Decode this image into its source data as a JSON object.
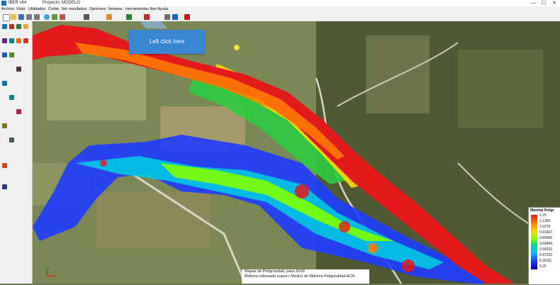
{
  "window": {
    "app_title": "IBER v64",
    "project_title": "Proyecto: MODELO",
    "minimize_glyph": "—",
    "maximize_glyph": "☐",
    "close_glyph": "✕"
  },
  "menubar": {
    "items": [
      "Archivo",
      "Vista",
      "Utilidades",
      "Cortar",
      "Ver resultados",
      "Opciones",
      "Ventana",
      "Herramientas Iber",
      "Ayuda"
    ]
  },
  "toolbar": {
    "icons": [
      "new-icon",
      "open-icon",
      "save-icon",
      "undo-icon",
      "redo-icon",
      "zoom-icon",
      "pan-icon",
      "rotate-icon",
      "print-icon",
      "layers-icon",
      "render-icon",
      "results-icon",
      "settings-icon",
      "help-icon",
      "exit-icon"
    ]
  },
  "sidebar": {
    "icons": [
      "point-icon",
      "line-icon",
      "arc-icon",
      "polyline-icon",
      "surface-icon",
      "volume-icon",
      "select-icon",
      "delete-icon",
      "copy-icon",
      "move-icon",
      "mesh-icon",
      "boundary-icon",
      "inlet-icon",
      "outlet-icon",
      "roughness-icon",
      "data-icon",
      "run-icon",
      "results-icon"
    ]
  },
  "tooltip": {
    "text": "Left click here"
  },
  "legend": {
    "title": "Máxima Peligr",
    "values": [
      "1.25",
      "1.1369",
      "1.0278",
      "0.91667",
      "0.80556",
      "0.69444",
      "0.58333",
      "0.47222",
      "0.36111",
      "0.25"
    ]
  },
  "caption": {
    "line1": "Mapas de Peligrosidad, paso 9100",
    "line2": "Relleno coloreado suave ( Medio) de Máxima Peligrosidad ACA."
  },
  "axes": {
    "x_label": "X",
    "y_label": "Y"
  },
  "colors": {
    "hazard_high": "#e31a1c",
    "hazard_mid": "#7fff00",
    "hazard_low": "#1e3cff",
    "tooltip_bg": "#3a86d1"
  }
}
